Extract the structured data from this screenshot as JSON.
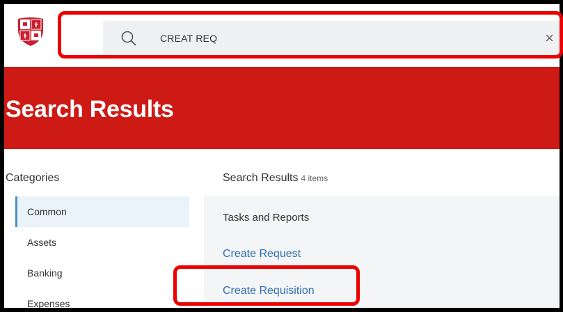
{
  "search": {
    "query": "CREAT REQ",
    "clear_label": "×"
  },
  "icons": {
    "logo": "shield-crest-icon",
    "search": "search-icon",
    "clear": "close-icon"
  },
  "colors": {
    "banner": "#ce1a14",
    "link": "#2b6fb4",
    "annotation": "#ec0000",
    "active_category": "#e9f3f9"
  },
  "banner": {
    "title": "Search Results"
  },
  "categories": {
    "heading": "Categories",
    "items": [
      {
        "label": "Common",
        "active": true
      },
      {
        "label": "Assets",
        "active": false
      },
      {
        "label": "Banking",
        "active": false
      },
      {
        "label": "Expenses",
        "active": false
      }
    ]
  },
  "results": {
    "heading": "Search Results",
    "count_label": "4 items",
    "section_label": "Tasks and Reports",
    "items": [
      {
        "label": "Create Request"
      },
      {
        "label": "Create Requisition"
      }
    ]
  }
}
